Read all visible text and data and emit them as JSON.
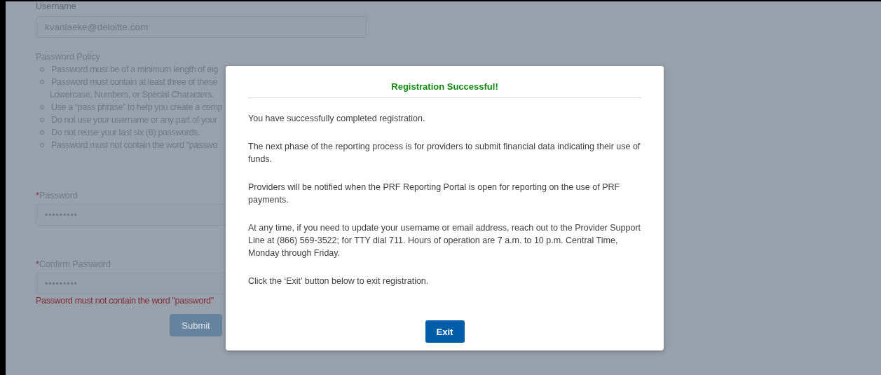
{
  "form": {
    "username": {
      "label": "Username",
      "value": "kvanlaeke@deloitte.com"
    },
    "policy": {
      "title": "Password Policy",
      "items": [
        {
          "text": "Password must be of a minimum length of eig"
        },
        {
          "text": "Password must contain at least three of these",
          "continuation": "Lowercase, Numbers, or Special Characters."
        },
        {
          "text": "Use a “pass phrase” to help you create a comp"
        },
        {
          "text": "Do not use your username or any part of your"
        },
        {
          "text": "Do not reuse your last six (6) passwords."
        },
        {
          "text": "Password must not contain the word \"passwo"
        }
      ]
    },
    "password": {
      "label": "Password",
      "required_mark": "*",
      "value": "•••••••••"
    },
    "confirm_password": {
      "label": "Confirm Password",
      "required_mark": "*",
      "value": "•••••••••",
      "error": "Password must not contain the word \"password\""
    },
    "submit_button": "Submit"
  },
  "modal": {
    "title": "Registration Successful!",
    "paragraphs": [
      "You have successfully completed registration.",
      "The next phase of the reporting process is for providers to submit financial data indicating their use of funds.",
      "Providers will be notified when the PRF Reporting Portal is open for reporting on the use of PRF payments.",
      "At any time, if you need to update your username or email address, reach out to the Provider Support Line at (866) 569-3522; for TTY dial 711. Hours of operation are 7 a.m. to 10 p.m. Central Time, Monday through Friday.",
      "Click the ‘Exit’ button below to exit registration."
    ],
    "exit_button": "Exit"
  }
}
